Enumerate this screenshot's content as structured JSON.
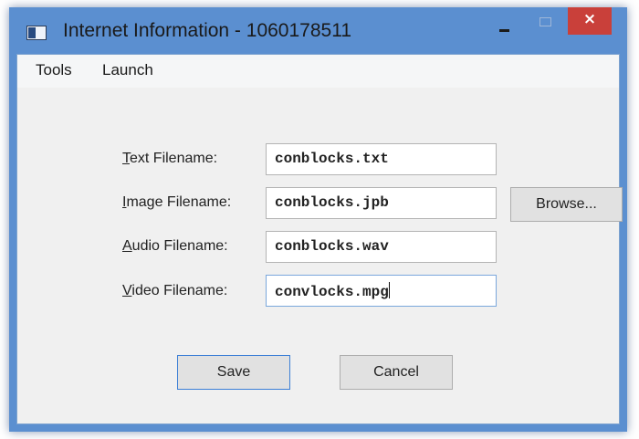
{
  "window": {
    "title": "Internet Information - 1060178511",
    "controls": {
      "minimize": "minimize",
      "maximize": "maximize",
      "close": "×"
    }
  },
  "menu": {
    "tools": "Tools",
    "launch": "Launch"
  },
  "form": {
    "text": {
      "label_mnemonic": "T",
      "label_rest": "ext Filename:",
      "value": "conblocks.txt"
    },
    "image": {
      "label_mnemonic": "I",
      "label_rest": "mage Filename:",
      "value": "conblocks.jpb"
    },
    "audio": {
      "label_mnemonic": "A",
      "label_rest": "udio Filename:",
      "value": "conblocks.wav"
    },
    "video": {
      "label_mnemonic": "V",
      "label_rest": "ideo Filename:",
      "value": "convlocks.mpg"
    }
  },
  "buttons": {
    "browse": "Browse...",
    "save": "Save",
    "cancel": "Cancel"
  },
  "colors": {
    "titlebar": "#5b8fd0",
    "close": "#c9403a",
    "client": "#f0f0f0",
    "focus_border": "#3c7fd6"
  }
}
